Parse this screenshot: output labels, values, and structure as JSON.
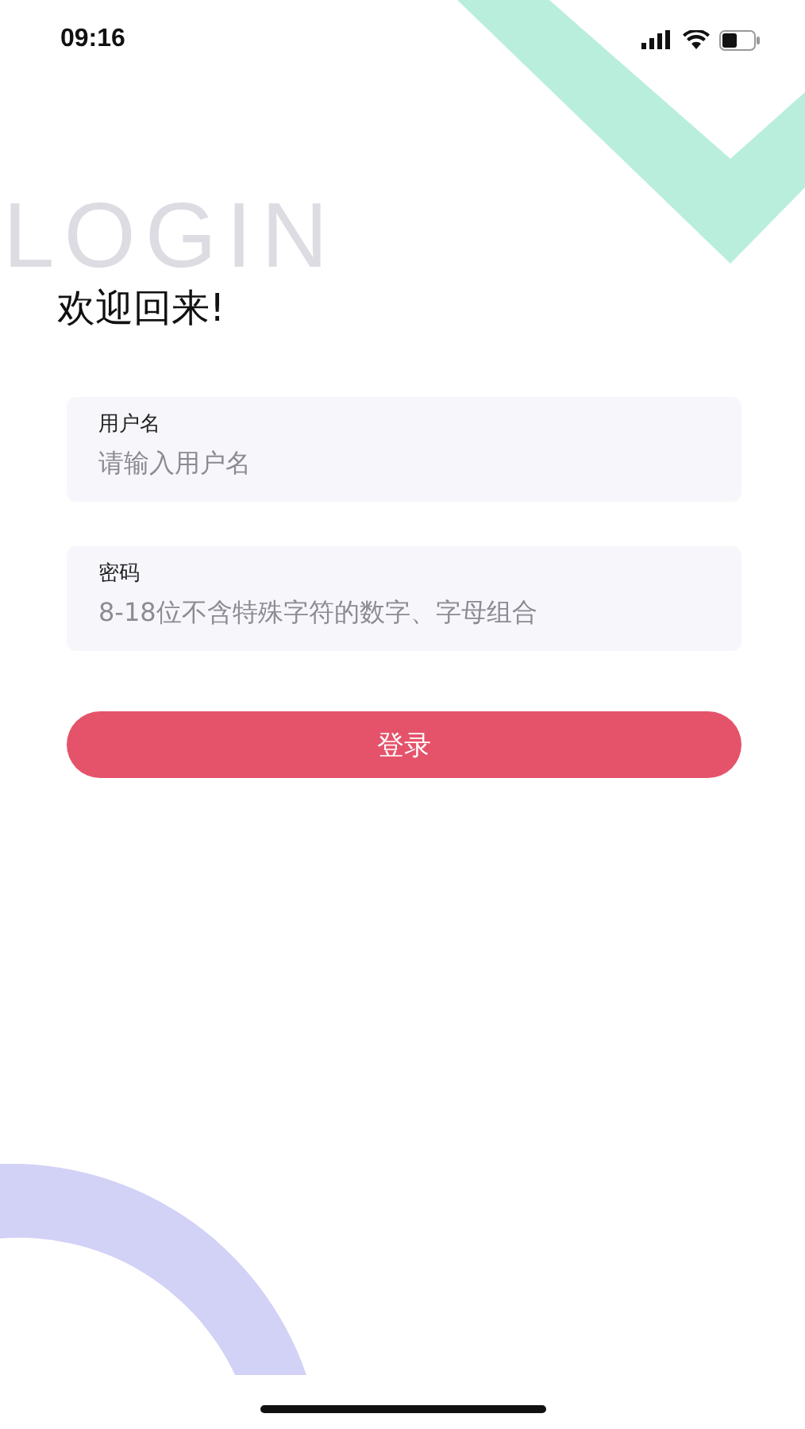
{
  "status_bar": {
    "time": "09:16"
  },
  "background_word": "LOGIN",
  "heading": "欢迎回来!",
  "fields": [
    {
      "label": "用户名",
      "placeholder": "请输入用户名"
    },
    {
      "label": "密码",
      "placeholder": "8-18位不含特殊字符的数字、字母组合"
    }
  ],
  "login_button": "登录"
}
